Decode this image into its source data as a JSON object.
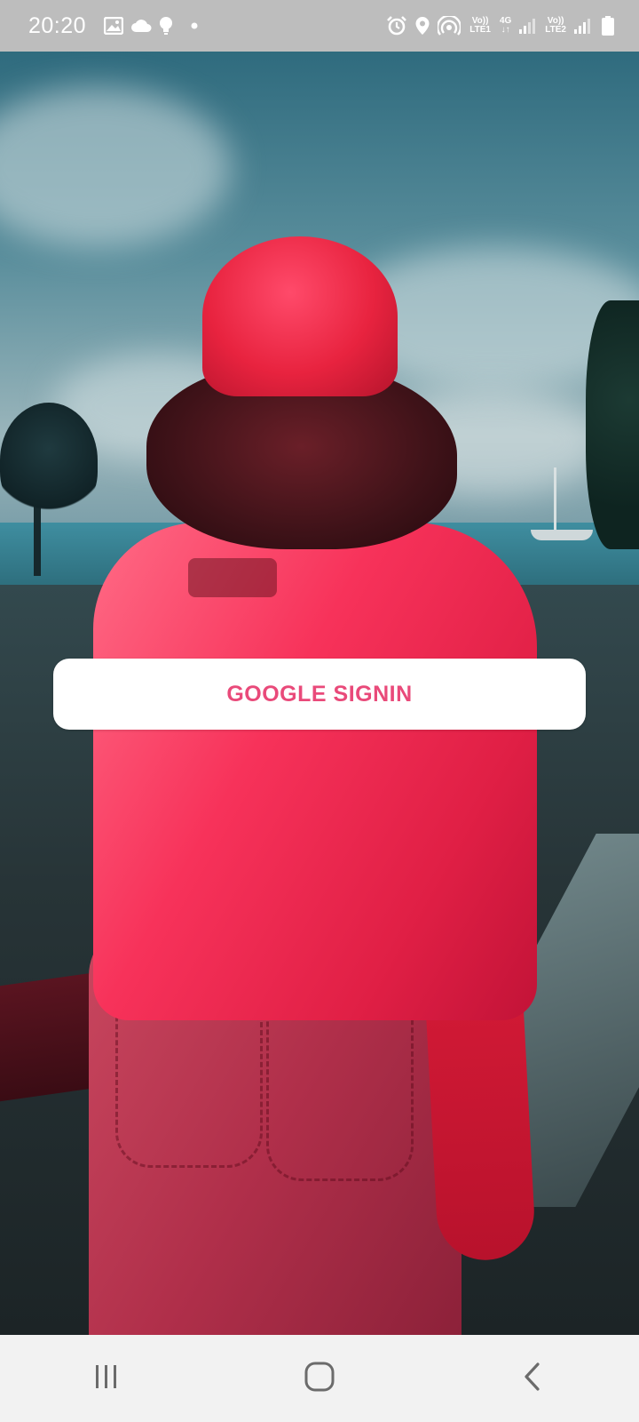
{
  "status_bar": {
    "time": "20:20",
    "left_icons": [
      "gallery-icon",
      "cloud-icon",
      "lightbulb-icon",
      "dot-icon"
    ],
    "right_icons": [
      "alarm-icon",
      "location-icon",
      "hotspot-icon",
      "network-lte1-icon",
      "signal-icon",
      "network-lte2-icon",
      "signal-icon",
      "battery-icon"
    ],
    "sim1": {
      "top": "Vo))",
      "bottom": "LTE1"
    },
    "net_type": {
      "top": "4G",
      "bottom": "↓↑"
    },
    "sim2": {
      "top": "Vo))",
      "bottom": "LTE2"
    },
    "color": "#bdbdbd"
  },
  "main": {
    "background": "photo-of-person-in-red-cap-and-shirt-by-the-sea",
    "signin_button": {
      "label": "GOOGLE SIGNIN",
      "text_color": "#e94a7a",
      "background": "#ffffff"
    }
  },
  "nav_bar": {
    "buttons": [
      "recent-apps-icon",
      "home-icon",
      "back-icon"
    ],
    "color": "#f2f2f2"
  }
}
